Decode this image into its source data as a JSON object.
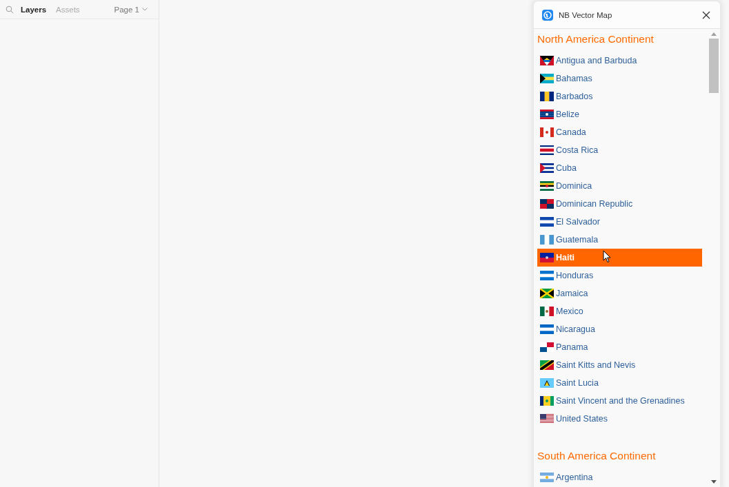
{
  "left_panel": {
    "tabs": [
      {
        "label": "Layers",
        "selected": true
      },
      {
        "label": "Assets",
        "selected": false
      }
    ],
    "page_menu": {
      "label": "Page 1"
    }
  },
  "plugin_window": {
    "title": "NB Vector Map",
    "sections": [
      {
        "title": "North America Continent",
        "items": [
          {
            "label": "Antigua and Barbuda",
            "selected": false
          },
          {
            "label": "Bahamas",
            "selected": false
          },
          {
            "label": "Barbados",
            "selected": false
          },
          {
            "label": "Belize",
            "selected": false
          },
          {
            "label": "Canada",
            "selected": false
          },
          {
            "label": "Costa Rica",
            "selected": false
          },
          {
            "label": "Cuba",
            "selected": false
          },
          {
            "label": "Dominica",
            "selected": false
          },
          {
            "label": "Dominican Republic",
            "selected": false
          },
          {
            "label": "El Salvador",
            "selected": false
          },
          {
            "label": "Guatemala",
            "selected": false
          },
          {
            "label": "Haiti",
            "selected": true
          },
          {
            "label": "Honduras",
            "selected": false
          },
          {
            "label": "Jamaica",
            "selected": false
          },
          {
            "label": "Mexico",
            "selected": false
          },
          {
            "label": "Nicaragua",
            "selected": false
          },
          {
            "label": "Panama",
            "selected": false
          },
          {
            "label": "Saint Kitts and Nevis",
            "selected": false
          },
          {
            "label": "Saint Lucia",
            "selected": false
          },
          {
            "label": "Saint Vincent and the Grenadines",
            "selected": false
          },
          {
            "label": "United States",
            "selected": false
          }
        ]
      },
      {
        "title": "South America Continent",
        "items": [
          {
            "label": "Argentina",
            "selected": false
          }
        ]
      }
    ]
  }
}
